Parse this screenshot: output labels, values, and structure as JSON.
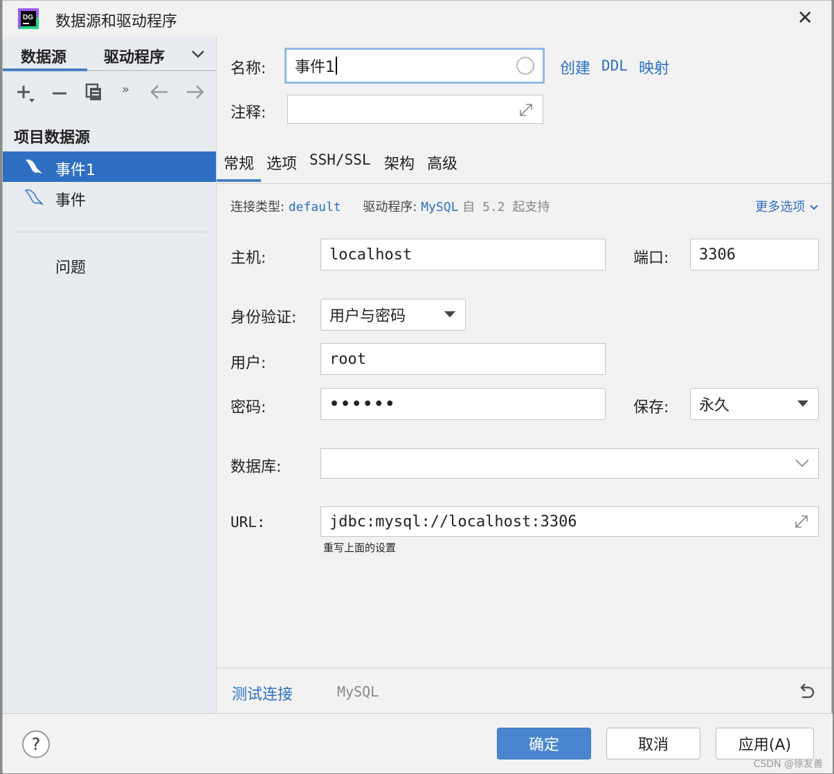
{
  "window": {
    "title": "数据源和驱动程序",
    "app_icon": "DG"
  },
  "left": {
    "tabs": [
      "数据源",
      "驱动程序"
    ],
    "section_title": "项目数据源",
    "items": [
      {
        "label": "事件1",
        "selected": true
      },
      {
        "label": "事件",
        "selected": false
      }
    ],
    "problems": "问题"
  },
  "form": {
    "name_label": "名称:",
    "name_value": "事件1",
    "links": [
      "创建",
      "DDL",
      "映射"
    ],
    "comment_label": "注释:",
    "comment_value": "",
    "tabs": [
      "常规",
      "选项",
      "SSH/SSL",
      "架构",
      "高级"
    ],
    "conn_type_label": "连接类型:",
    "conn_type_value": "default",
    "driver_label": "驱动程序:",
    "driver_value": "MySQL",
    "driver_suffix": "自 5.2 起支持",
    "more_options": "更多选项",
    "host_label": "主机:",
    "host_value": "localhost",
    "port_label": "端口:",
    "port_value": "3306",
    "auth_label": "身份验证:",
    "auth_value": "用户与密码",
    "user_label": "用户:",
    "user_value": "root",
    "password_label": "密码:",
    "password_value": "••••••",
    "save_label": "保存:",
    "save_value": "永久",
    "database_label": "数据库:",
    "database_value": "",
    "url_label": "URL:",
    "url_value": "jdbc:mysql://localhost:3306",
    "url_hint": "重写上面的设置",
    "test_connection": "测试连接",
    "db_type": "MySQL"
  },
  "footer": {
    "help": "?",
    "ok": "确定",
    "cancel": "取消",
    "apply": "应用(A)"
  },
  "watermark": "CSDN @徐友善",
  "colors": {
    "accent": "#2f6fc2",
    "selected_bg": "#2f6fc2",
    "primary_button": "#4a86d0"
  }
}
